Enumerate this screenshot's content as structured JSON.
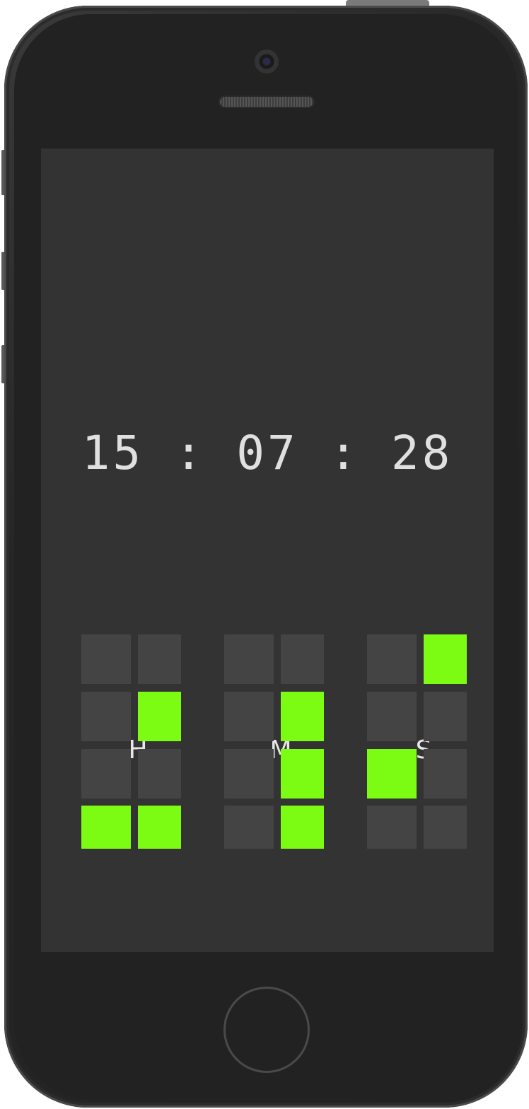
{
  "clock": {
    "time": "15 : 07 : 28",
    "hours": 15,
    "minutes": 7,
    "seconds": 28
  },
  "labels": {
    "hours": "H",
    "minutes": "M",
    "seconds": "S"
  },
  "colors": {
    "screen": "#333333",
    "cell_off": "#444444",
    "cell_on": "#7cfc12",
    "text": "#e0e0e0"
  },
  "grid": {
    "hours": [
      [
        0,
        0
      ],
      [
        0,
        1
      ],
      [
        0,
        0
      ],
      [
        1,
        1
      ]
    ],
    "minutes": [
      [
        0,
        0
      ],
      [
        0,
        1
      ],
      [
        0,
        1
      ],
      [
        0,
        1
      ]
    ],
    "seconds": [
      [
        0,
        1
      ],
      [
        0,
        0
      ],
      [
        1,
        0
      ],
      [
        0,
        0
      ]
    ]
  }
}
